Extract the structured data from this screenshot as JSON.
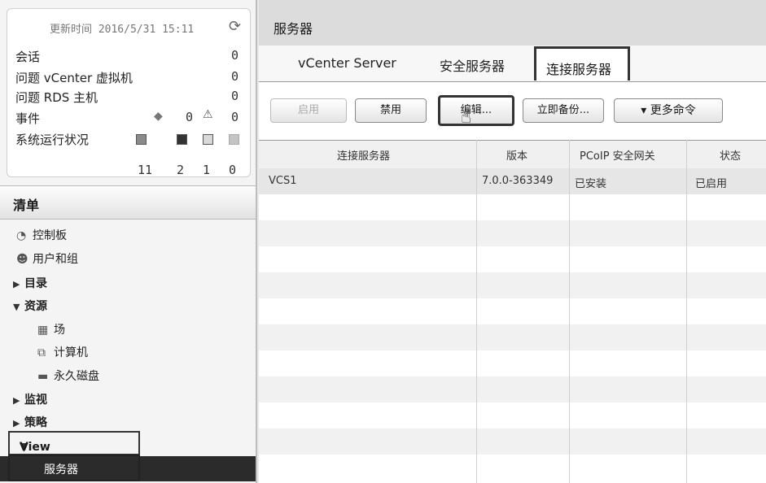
{
  "status": {
    "update_time": "更新时间 2016/5/31 15:11",
    "rows": [
      {
        "label": "会话",
        "value": "0"
      },
      {
        "label": "问题 vCenter 虚拟机",
        "value": "0"
      },
      {
        "label": "问题 RDS 主机",
        "value": "0"
      },
      {
        "label": "事件",
        "value": "0"
      }
    ],
    "event_warn_count": "0",
    "health_label": "系统运行状况",
    "health_counts": [
      "11",
      "2",
      "1",
      "0"
    ]
  },
  "inventory": {
    "title": "清单",
    "items": [
      {
        "label": "控制板"
      },
      {
        "label": "用户和组"
      },
      {
        "label": "目录"
      },
      {
        "label": "资源"
      },
      {
        "label": "场"
      },
      {
        "label": "计算机"
      },
      {
        "label": "永久磁盘"
      },
      {
        "label": "监视"
      },
      {
        "label": "策略"
      },
      {
        "label": "View 配置"
      },
      {
        "label": "服务器"
      }
    ]
  },
  "main": {
    "title": "服务器",
    "tabs": [
      {
        "label": "vCenter Server"
      },
      {
        "label": "安全服务器"
      },
      {
        "label": "连接服务器"
      }
    ],
    "buttons": {
      "enable": "启用",
      "disable": "禁用",
      "edit": "编辑...",
      "backup": "立即备份...",
      "more": "▾ 更多命令"
    },
    "table": {
      "columns": [
        "连接服务器",
        "版本",
        "PCoIP 安全网关",
        "状态"
      ],
      "rows": [
        [
          "VCS1",
          "7.0.0-363349",
          "已安装",
          "已启用"
        ]
      ]
    }
  }
}
